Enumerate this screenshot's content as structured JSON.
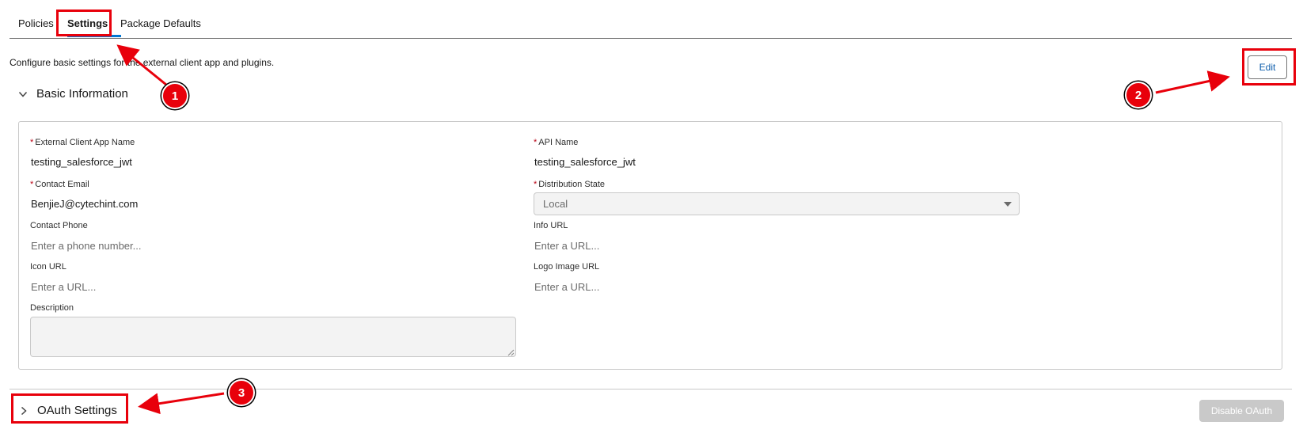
{
  "tabs": [
    {
      "label": "Policies"
    },
    {
      "label": "Settings"
    },
    {
      "label": "Package Defaults"
    }
  ],
  "description": "Configure basic settings for the external client app and plugins.",
  "edit_label": "Edit",
  "basic_info": {
    "title": "Basic Information",
    "app_name_label": "External Client App Name",
    "app_name_value": "testing_salesforce_jwt",
    "api_name_label": "API Name",
    "api_name_value": "testing_salesforce_jwt",
    "contact_email_label": "Contact Email",
    "contact_email_value": "BenjieJ@cytechint.com",
    "distribution_state_label": "Distribution State",
    "distribution_state_value": "Local",
    "contact_phone_label": "Contact Phone",
    "contact_phone_placeholder": "Enter a phone number...",
    "info_url_label": "Info URL",
    "info_url_placeholder": "Enter a URL...",
    "icon_url_label": "Icon URL",
    "icon_url_placeholder": "Enter a URL...",
    "logo_url_label": "Logo Image URL",
    "logo_url_placeholder": "Enter a URL...",
    "description_label": "Description",
    "required_mark": "*"
  },
  "oauth": {
    "title": "OAuth Settings",
    "disable_label": "Disable OAuth"
  },
  "annotations": {
    "badge_1": "1",
    "badge_2": "2",
    "badge_3": "3",
    "color": "#e8000b"
  },
  "icons": {
    "basic_info_chevron": "chevron-down-icon",
    "oauth_chevron": "chevron-right-icon",
    "select_caret": "caret-down-icon"
  },
  "colors": {
    "brand": "#0176d3",
    "link": "#0b5cab",
    "required": "#ba0517"
  }
}
